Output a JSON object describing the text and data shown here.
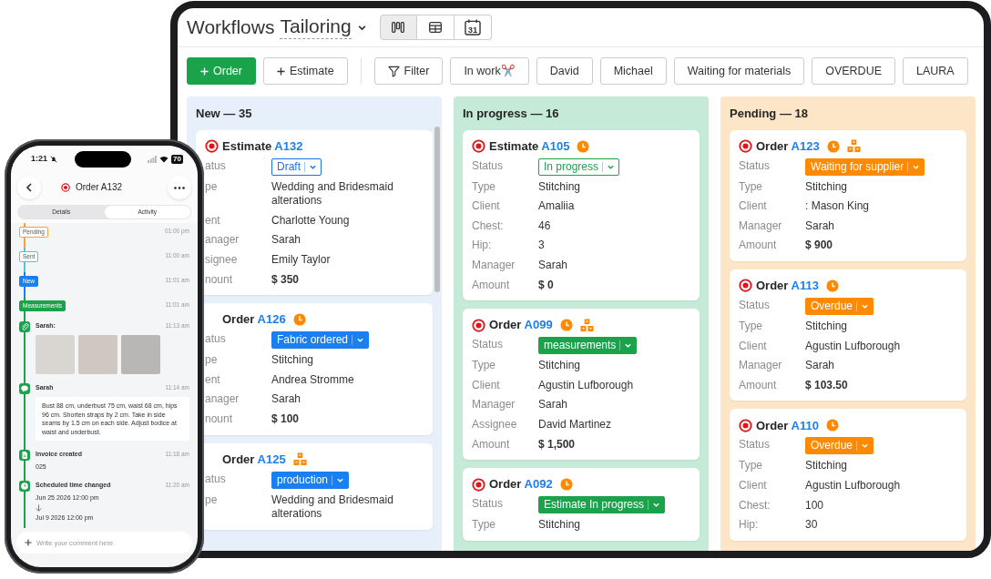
{
  "tablet": {
    "title": "Workflows",
    "workflow": "Tailoring",
    "views": [
      {
        "kind": "board",
        "selected": true
      },
      {
        "kind": "table",
        "selected": false
      },
      {
        "kind": "calendar",
        "day": "31",
        "selected": false
      }
    ],
    "actions": [
      {
        "label": "Order",
        "kind": "primary"
      },
      {
        "label": "Estimate",
        "kind": "secondary"
      }
    ],
    "filters": [
      {
        "label": "Filter",
        "kind": "filter"
      },
      {
        "label": "In work✂️",
        "kind": "chip"
      },
      {
        "label": "David",
        "kind": "chip"
      },
      {
        "label": "Michael",
        "kind": "chip"
      },
      {
        "label": "Waiting for materials",
        "kind": "chip"
      },
      {
        "label": "OVERDUE",
        "kind": "chip"
      },
      {
        "label": "LAURA",
        "kind": "chip"
      }
    ],
    "columns": [
      {
        "title": "New — 35",
        "color": "#e7effb",
        "cards": [
          {
            "type": "Estimate",
            "number": "A132",
            "target": true,
            "clock": false,
            "boxes": false,
            "status_label": "atus",
            "status": {
              "text": "Draft",
              "color": "#1a73e8",
              "outlined": true
            },
            "fields": [
              {
                "label": "pe",
                "value": "Wedding and Bridesmaid alterations",
                "bold": false
              },
              {
                "label": "ent",
                "value": "Charlotte Young",
                "bold": false
              },
              {
                "label": "anager",
                "value": "Sarah",
                "bold": false
              },
              {
                "label": "signee",
                "value": "Emily Taylor",
                "bold": false
              },
              {
                "label": "nount",
                "value": "$ 350",
                "bold": true
              }
            ]
          },
          {
            "type": "Order",
            "number": "A126",
            "target": false,
            "clock": true,
            "boxes": false,
            "status_label": "atus",
            "status": {
              "text": "Fabric ordered",
              "color": "#1a7ff0",
              "outlined": false
            },
            "fields": [
              {
                "label": "pe",
                "value": "Stitching",
                "bold": false
              },
              {
                "label": "ent",
                "value": "Andrea Stromme",
                "bold": false
              },
              {
                "label": "anager",
                "value": "Sarah",
                "bold": false
              },
              {
                "label": "nount",
                "value": "$ 100",
                "bold": true
              }
            ]
          },
          {
            "type": "Order",
            "number": "A125",
            "target": false,
            "clock": false,
            "boxes": true,
            "status_label": "atus",
            "status": {
              "text": "production",
              "color": "#1a7ff0",
              "outlined": false
            },
            "fields": [
              {
                "label": "pe",
                "value": "Wedding and Bridesmaid alterations",
                "bold": false
              }
            ]
          }
        ]
      },
      {
        "title": "In progress — 16",
        "color": "#c5ead7",
        "cards": [
          {
            "type": "Estimate",
            "number": "A105",
            "target": true,
            "clock": true,
            "boxes": false,
            "status_label": "Status",
            "status": {
              "text": "In progress",
              "color": "#1aa34a",
              "outlined": true
            },
            "fields": [
              {
                "label": "Type",
                "value": "Stitching",
                "bold": false
              },
              {
                "label": "Client",
                "value": "Amaliia",
                "bold": false
              },
              {
                "label": "Chest:",
                "value": "46",
                "bold": false
              },
              {
                "label": "Hip:",
                "value": "3",
                "bold": false
              },
              {
                "label": "Manager",
                "value": "Sarah",
                "bold": false
              },
              {
                "label": "Amount",
                "value": "$ 0",
                "bold": true
              }
            ]
          },
          {
            "type": "Order",
            "number": "A099",
            "target": true,
            "clock": true,
            "boxes": true,
            "status_label": "Status",
            "status": {
              "text": "measurements",
              "color": "#1aa34a",
              "outlined": false
            },
            "fields": [
              {
                "label": "Type",
                "value": "Stitching",
                "bold": false
              },
              {
                "label": "Client",
                "value": "Agustin Lufborough",
                "bold": false
              },
              {
                "label": "Manager",
                "value": "Sarah",
                "bold": false
              },
              {
                "label": "Assignee",
                "value": "David Martinez",
                "bold": false
              },
              {
                "label": "Amount",
                "value": "$ 1,500",
                "bold": true
              }
            ]
          },
          {
            "type": "Order",
            "number": "A092",
            "target": true,
            "clock": true,
            "boxes": false,
            "status_label": "Status",
            "status": {
              "text": "Estimate In progress",
              "color": "#1aa34a",
              "outlined": false
            },
            "fields": [
              {
                "label": "Type",
                "value": "Stitching",
                "bold": false
              }
            ]
          }
        ]
      },
      {
        "title": "Pending — 18",
        "color": "#fde5c7",
        "cards": [
          {
            "type": "Order",
            "number": "A123",
            "target": true,
            "clock": true,
            "boxes": true,
            "status_label": "Status",
            "status": {
              "text": "Waiting for supplier",
              "color": "#ff8a00",
              "outlined": false
            },
            "fields": [
              {
                "label": "Type",
                "value": "Stitching",
                "bold": false
              },
              {
                "label": "Client",
                "value": ": Mason King",
                "bold": false
              },
              {
                "label": "Manager",
                "value": "Sarah",
                "bold": false
              },
              {
                "label": "Amount",
                "value": "$ 900",
                "bold": true
              }
            ]
          },
          {
            "type": "Order",
            "number": "A113",
            "target": true,
            "clock": true,
            "boxes": false,
            "status_label": "Status",
            "status": {
              "text": "Overdue",
              "color": "#ff8a00",
              "outlined": false
            },
            "fields": [
              {
                "label": "Type",
                "value": "Stitching",
                "bold": false
              },
              {
                "label": "Client",
                "value": "Agustin Lufborough",
                "bold": false
              },
              {
                "label": "Manager",
                "value": "Sarah",
                "bold": false
              },
              {
                "label": "Amount",
                "value": "$ 103.50",
                "bold": true
              }
            ]
          },
          {
            "type": "Order",
            "number": "A110",
            "target": true,
            "clock": true,
            "boxes": false,
            "status_label": "Status",
            "status": {
              "text": "Overdue",
              "color": "#ff8a00",
              "outlined": false
            },
            "fields": [
              {
                "label": "Type",
                "value": "Stitching",
                "bold": false
              },
              {
                "label": "Client",
                "value": "Agustin Lufborough",
                "bold": false
              },
              {
                "label": "Chest:",
                "value": "100",
                "bold": false
              },
              {
                "label": "Hip:",
                "value": "30",
                "bold": false
              }
            ]
          }
        ]
      }
    ]
  },
  "phone": {
    "time": "1:21",
    "battery": "70",
    "title": "Order A132",
    "tabs": [
      {
        "label": "Details",
        "selected": false
      },
      {
        "label": "Activity",
        "selected": true
      }
    ],
    "timeline": [
      {
        "kind": "status",
        "label": "Pending",
        "color": "#f5a043",
        "outlined": true,
        "time": "01:00 pm"
      },
      {
        "kind": "status",
        "label": "Sent",
        "color": "#52c3dd",
        "outlined": true,
        "time": "11:00 am"
      },
      {
        "kind": "status",
        "label": "New",
        "color": "#1a7ff0",
        "outlined": false,
        "time": "11:01 am"
      },
      {
        "kind": "status",
        "label": "Measurements",
        "color": "#1aa34a",
        "outlined": false,
        "time": "11:01 am"
      },
      {
        "kind": "photos",
        "author": "Sarah:",
        "time": "11:13 am",
        "photos": [
          {
            "kind": "photo"
          },
          {
            "kind": "photo"
          },
          {
            "kind": "photo"
          }
        ]
      },
      {
        "kind": "message",
        "author": "Sarah",
        "time": "11:14 am",
        "text": "Bust 88 cm, underbust 75 cm, waist 68 cm, hips 96 cm. Shorten straps by 2 cm. Take in side seams by 1.5 cm on each side. Adjust bodice at waist and underbust."
      },
      {
        "kind": "document",
        "title": "Invoice created",
        "time": "11:18 am",
        "lines": [
          "025"
        ]
      },
      {
        "kind": "schedule",
        "title": "Scheduled time changed",
        "time": "11:20 am",
        "from": "Jun 25 2026 12:00 pm",
        "to": "Jul 9 2026 12:00 pm"
      }
    ],
    "comment": {
      "placeholder": "Write your comment here"
    }
  }
}
